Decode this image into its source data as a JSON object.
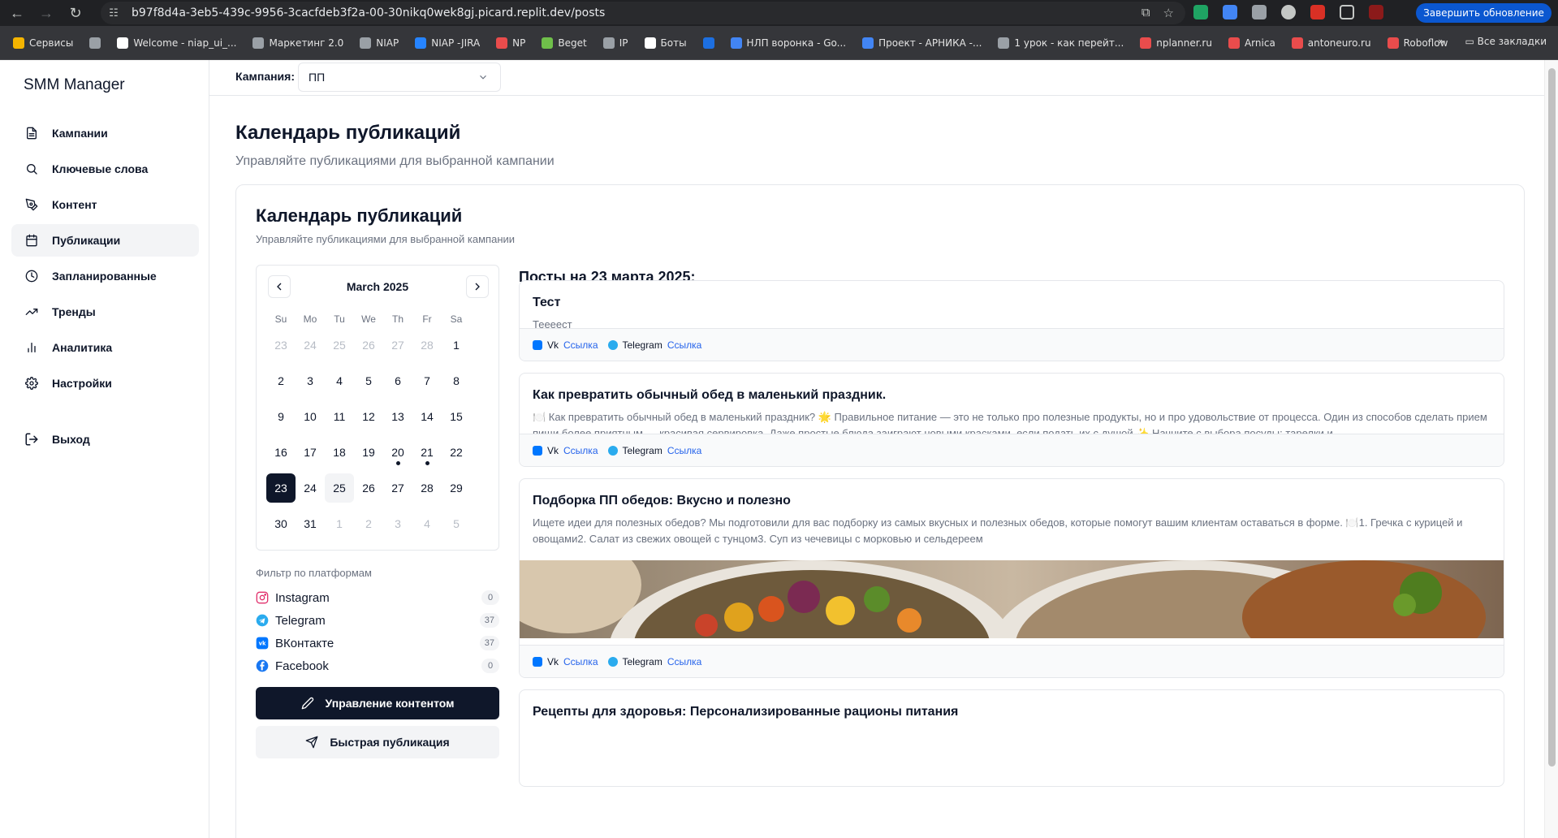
{
  "browser": {
    "url_host": "b97f8d4a-3eb5-439c-9956-3cacfdeb3f2a-00-30nikq0wek8gj.picard.replit.dev",
    "url_path": "/posts",
    "update_button": "Завершить обновление",
    "bookmarks": [
      {
        "label": "Сервисы",
        "color": "#f4b400"
      },
      {
        "label": "",
        "color": "#9aa0a6"
      },
      {
        "label": "Welcome - niap_ui_...",
        "color": "#ffffff"
      },
      {
        "label": "Маркетинг 2.0",
        "color": "#9aa0a6"
      },
      {
        "label": "NIAP",
        "color": "#9aa0a6"
      },
      {
        "label": "NIAP -JIRA",
        "color": "#2684ff"
      },
      {
        "label": "NP",
        "color": "#e94c4c"
      },
      {
        "label": "Beget",
        "color": "#6fbf4a"
      },
      {
        "label": "IP",
        "color": "#9aa0a6"
      },
      {
        "label": "Боты",
        "color": "#ffffff"
      },
      {
        "label": "",
        "color": "#1d6fe0"
      },
      {
        "label": "НЛП воронка - Go...",
        "color": "#4285f4"
      },
      {
        "label": "Проект - АРНИКА -...",
        "color": "#4285f4"
      },
      {
        "label": "1 урок - как перейт...",
        "color": "#9aa0a6"
      },
      {
        "label": "nplanner.ru",
        "color": "#e94c4c"
      },
      {
        "label": "Arnica",
        "color": "#e94c4c"
      },
      {
        "label": "antoneuro.ru",
        "color": "#e94c4c"
      },
      {
        "label": "Roboflow",
        "color": "#e94c4c"
      }
    ],
    "all_bookmarks": "Все закладки"
  },
  "sidebar": {
    "brand": "SMM Manager",
    "items": [
      {
        "label": "Кампании",
        "icon": "document-icon"
      },
      {
        "label": "Ключевые слова",
        "icon": "search-icon"
      },
      {
        "label": "Контент",
        "icon": "pen-tool-icon"
      },
      {
        "label": "Публикации",
        "icon": "calendar-icon"
      },
      {
        "label": "Запланированные",
        "icon": "clock-icon"
      },
      {
        "label": "Тренды",
        "icon": "trending-icon"
      },
      {
        "label": "Аналитика",
        "icon": "bar-chart-icon"
      },
      {
        "label": "Настройки",
        "icon": "gear-icon"
      }
    ],
    "active_index": 3,
    "logout": "Выход"
  },
  "topbar": {
    "campaign_label": "Кампания:",
    "campaign_value": "ПП"
  },
  "header": {
    "title": "Календарь публикаций",
    "subtitle": "Управляйте публикациями для выбранной кампании"
  },
  "card": {
    "title": "Календарь публикаций",
    "subtitle": "Управляйте публикациями для выбранной кампании"
  },
  "calendar": {
    "month": "March 2025",
    "weekdays": [
      "Su",
      "Mo",
      "Tu",
      "We",
      "Th",
      "Fr",
      "Sa"
    ],
    "weeks": [
      [
        {
          "d": "23",
          "out": true
        },
        {
          "d": "24",
          "out": true
        },
        {
          "d": "25",
          "out": true
        },
        {
          "d": "26",
          "out": true
        },
        {
          "d": "27",
          "out": true
        },
        {
          "d": "28",
          "out": true
        },
        {
          "d": "1"
        }
      ],
      [
        {
          "d": "2"
        },
        {
          "d": "3"
        },
        {
          "d": "4"
        },
        {
          "d": "5"
        },
        {
          "d": "6"
        },
        {
          "d": "7"
        },
        {
          "d": "8"
        }
      ],
      [
        {
          "d": "9"
        },
        {
          "d": "10"
        },
        {
          "d": "11"
        },
        {
          "d": "12"
        },
        {
          "d": "13"
        },
        {
          "d": "14"
        },
        {
          "d": "15"
        }
      ],
      [
        {
          "d": "16"
        },
        {
          "d": "17"
        },
        {
          "d": "18"
        },
        {
          "d": "19"
        },
        {
          "d": "20",
          "dot": true
        },
        {
          "d": "21",
          "dot": true
        },
        {
          "d": "22"
        }
      ],
      [
        {
          "d": "23",
          "selected": true
        },
        {
          "d": "24"
        },
        {
          "d": "25",
          "today": true
        },
        {
          "d": "26"
        },
        {
          "d": "27"
        },
        {
          "d": "28"
        },
        {
          "d": "29"
        }
      ],
      [
        {
          "d": "30"
        },
        {
          "d": "31"
        },
        {
          "d": "1",
          "out": true
        },
        {
          "d": "2",
          "out": true
        },
        {
          "d": "3",
          "out": true
        },
        {
          "d": "4",
          "out": true
        },
        {
          "d": "5",
          "out": true
        }
      ]
    ]
  },
  "filters": {
    "title": "Фильтр по платформам",
    "items": [
      {
        "label": "Instagram",
        "count": "0",
        "color": "#e1306c"
      },
      {
        "label": "Telegram",
        "count": "37",
        "color": "#2aabee"
      },
      {
        "label": "ВКонтакте",
        "count": "37",
        "color": "#0077ff"
      },
      {
        "label": "Facebook",
        "count": "0",
        "color": "#1877f2"
      }
    ]
  },
  "buttons": {
    "manage": "Управление контентом",
    "quick": "Быстрая публикация"
  },
  "posts": {
    "heading": "Посты на 23 марта 2025:",
    "platform_vk": "Vk",
    "platform_tg": "Telegram",
    "link_label": "Ссылка",
    "items": [
      {
        "title": "Тест",
        "text": "Теееест"
      },
      {
        "title": "Как превратить обычный обед в маленький праздник.",
        "text": "🍽️ Как превратить обычный обед в маленький праздник? 🌟 Правильное питание — это не только про полезные продукты, но и про удовольствие от процесса. Один из способов сделать прием пищи более приятным — красивая сервировка. Даже простые блюда заиграют новыми красками, если подать их с душой.✨ Начните с выбора посуды: тарелки и..."
      },
      {
        "title": "Подборка ПП обедов: Вкусно и полезно",
        "text": "Ищете идеи для полезных обедов? Мы подготовили для вас подборку из самых вкусных и полезных обедов, которые помогут вашим клиентам оставаться в форме. 🍽️1. Гречка с курицей и овощами2. Салат из свежих овощей с тунцом3. Суп из чечевицы с морковью и сельдереем"
      },
      {
        "title": "Рецепты для здоровья: Персонализированные рационы питания",
        "text": ""
      }
    ]
  }
}
